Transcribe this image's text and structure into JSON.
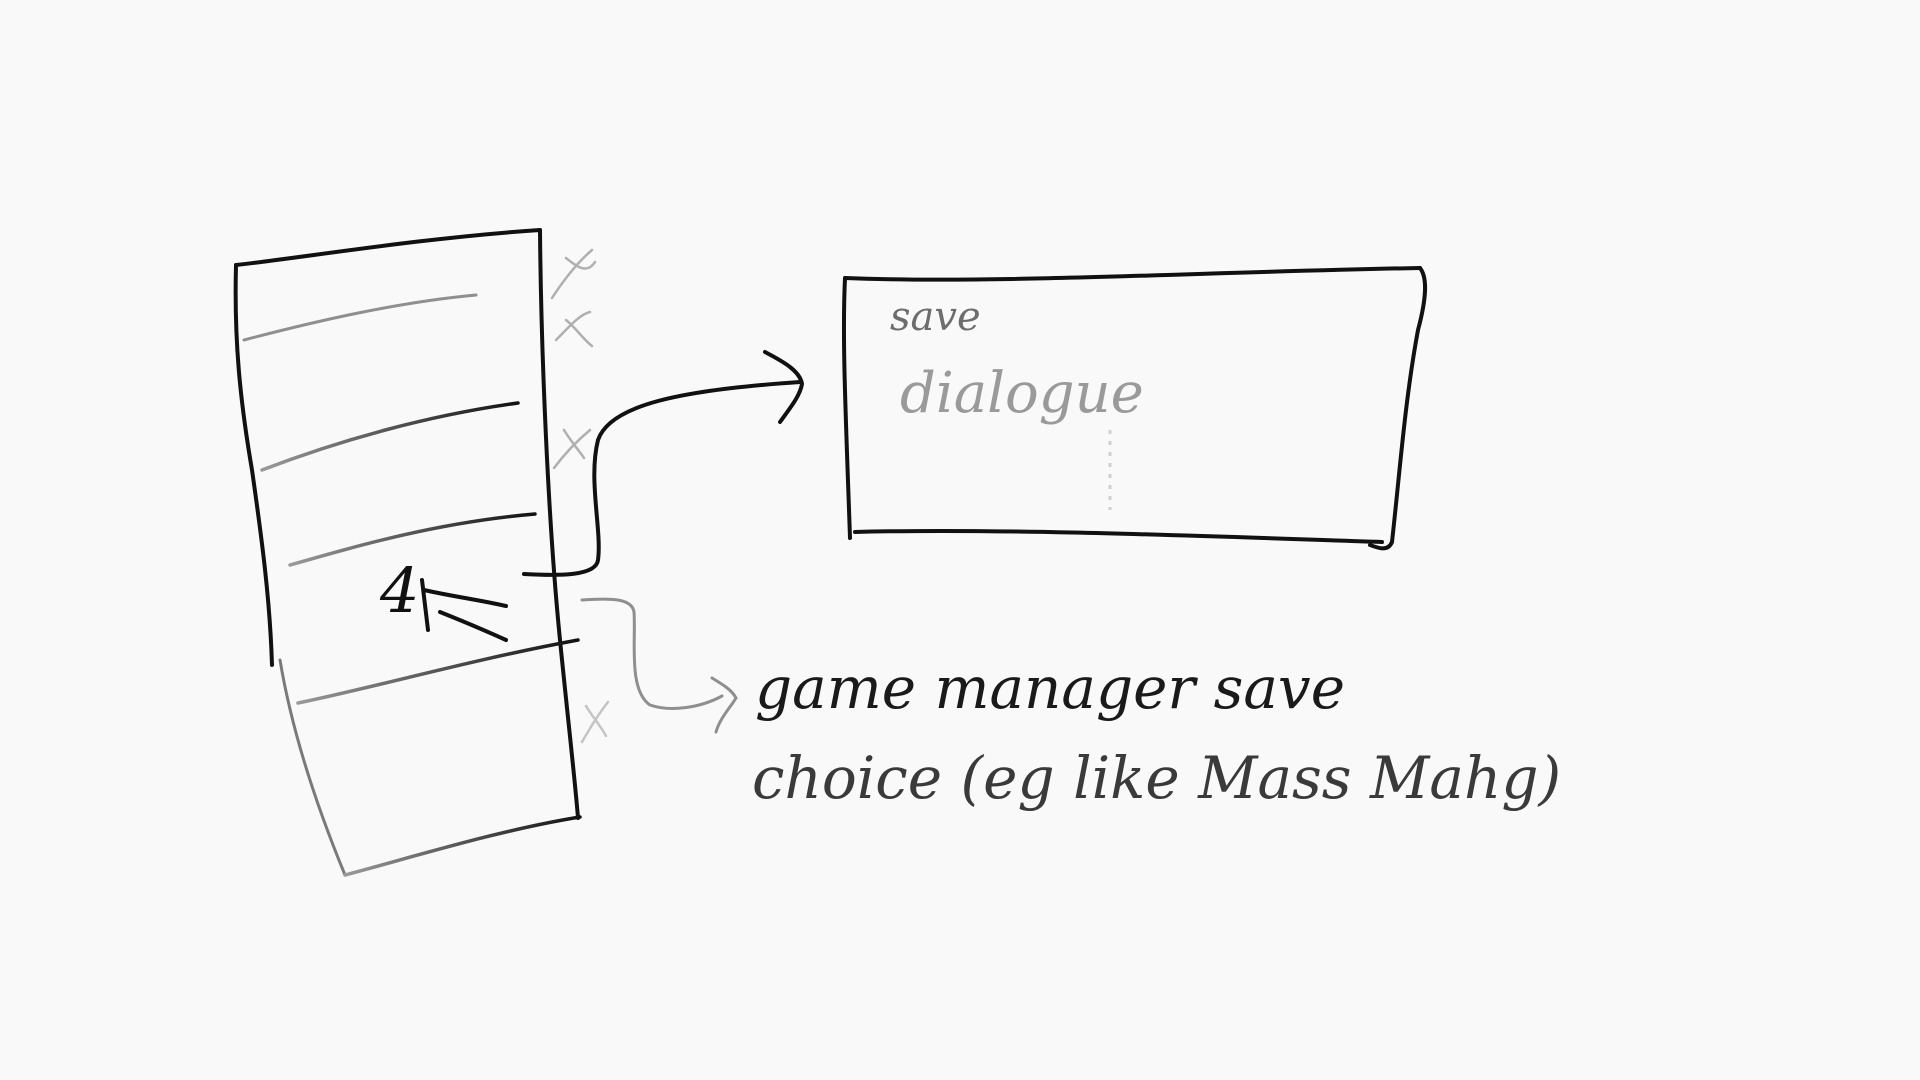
{
  "sketch": {
    "type": "hand-drawn wireframe",
    "ink_color": "#111111",
    "faint_ink_color": "#8a8a8a",
    "background_color": "#f9f9f9"
  },
  "list_panel": {
    "selected_row_label": "4"
  },
  "dialog": {
    "label_line_1": "save",
    "label_line_2": "dialogue"
  },
  "annotation": {
    "line_1": "game manager save",
    "line_2": "choice (eg like Mass Mahg)"
  }
}
